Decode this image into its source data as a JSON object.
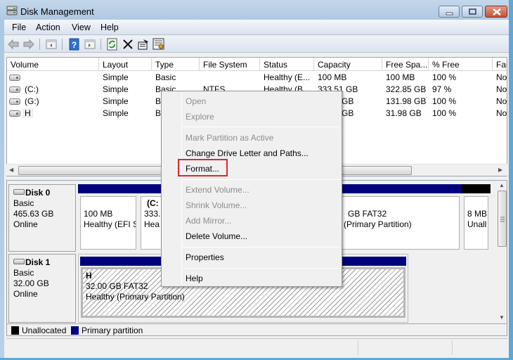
{
  "window": {
    "title": "Disk Management",
    "icon": "disk-management-icon",
    "controls": [
      "minimize",
      "maximize",
      "close"
    ]
  },
  "menubar": {
    "items": [
      "File",
      "Action",
      "View",
      "Help"
    ]
  },
  "toolbar": {
    "buttons": [
      "back-arrow-icon",
      "forward-arrow-icon",
      "show-hide-console-tree-icon",
      "help-icon",
      "show-hide-action-pane-icon",
      "refresh-icon",
      "delete-icon",
      "properties-icon",
      "settings-icon"
    ]
  },
  "volume_list": {
    "columns": [
      "Volume",
      "Layout",
      "Type",
      "File System",
      "Status",
      "Capacity",
      "Free Spa...",
      "% Free",
      "Fau"
    ],
    "rows": [
      {
        "volume": "",
        "layout": "Simple",
        "type": "Basic",
        "fs": "",
        "status": "Healthy (E...",
        "capacity": "100 MB",
        "free": "100 MB",
        "pct": "100 %",
        "fault": "No"
      },
      {
        "volume": "(C:)",
        "layout": "Simple",
        "type": "Basic",
        "fs": "NTFS",
        "status": "Healthy (B...",
        "capacity": "333.51 GB",
        "free": "322.85 GB",
        "pct": "97 %",
        "fault": "No"
      },
      {
        "volume": "(G:)",
        "layout": "Simple",
        "type": "Basic",
        "fs": "",
        "status": "",
        "capacity": "GB",
        "free": "131.98 GB",
        "pct": "100 %",
        "fault": "No"
      },
      {
        "volume": "H",
        "layout": "Simple",
        "type": "Basic",
        "fs": "",
        "status": "",
        "capacity": "GB",
        "free": "31.98 GB",
        "pct": "100 %",
        "fault": "No"
      }
    ]
  },
  "disks": [
    {
      "name": "Disk 0",
      "type": "Basic",
      "size": "465.63 GB",
      "state": "Online",
      "partitions": [
        {
          "line1": "",
          "line2": "100 MB",
          "line3": "Healthy (EFI S"
        },
        {
          "line1": "(C:",
          "line2": "333.",
          "line3": "Hea"
        },
        {
          "line1": "",
          "line2": "GB FAT32",
          "line3": "(Primary Partition)"
        },
        {
          "line1": "",
          "line2": "8 MB",
          "line3": "Unall"
        }
      ]
    },
    {
      "name": "Disk 1",
      "type": "Basic",
      "size": "32.00 GB",
      "state": "Online",
      "partitions": [
        {
          "line1": "H",
          "line2": "32.00 GB FAT32",
          "line3": "Healthy (Primary Partition)"
        }
      ]
    }
  ],
  "legend": [
    {
      "label": "Unallocated",
      "color": "#000000"
    },
    {
      "label": "Primary partition",
      "color": "#00007e"
    }
  ],
  "context_menu": {
    "items": [
      {
        "label": "Open",
        "enabled": false
      },
      {
        "label": "Explore",
        "enabled": false
      },
      {
        "label": "Mark Partition as Active",
        "enabled": false
      },
      {
        "label": "Change Drive Letter and Paths...",
        "enabled": true
      },
      {
        "label": "Format...",
        "enabled": true,
        "highlighted": true
      },
      {
        "label": "Extend Volume...",
        "enabled": false
      },
      {
        "label": "Shrink Volume...",
        "enabled": false
      },
      {
        "label": "Add Mirror...",
        "enabled": false
      },
      {
        "label": "Delete Volume...",
        "enabled": true
      },
      {
        "label": "Properties",
        "enabled": true
      },
      {
        "label": "Help",
        "enabled": true
      }
    ],
    "highlight_color": "#e0262a"
  }
}
